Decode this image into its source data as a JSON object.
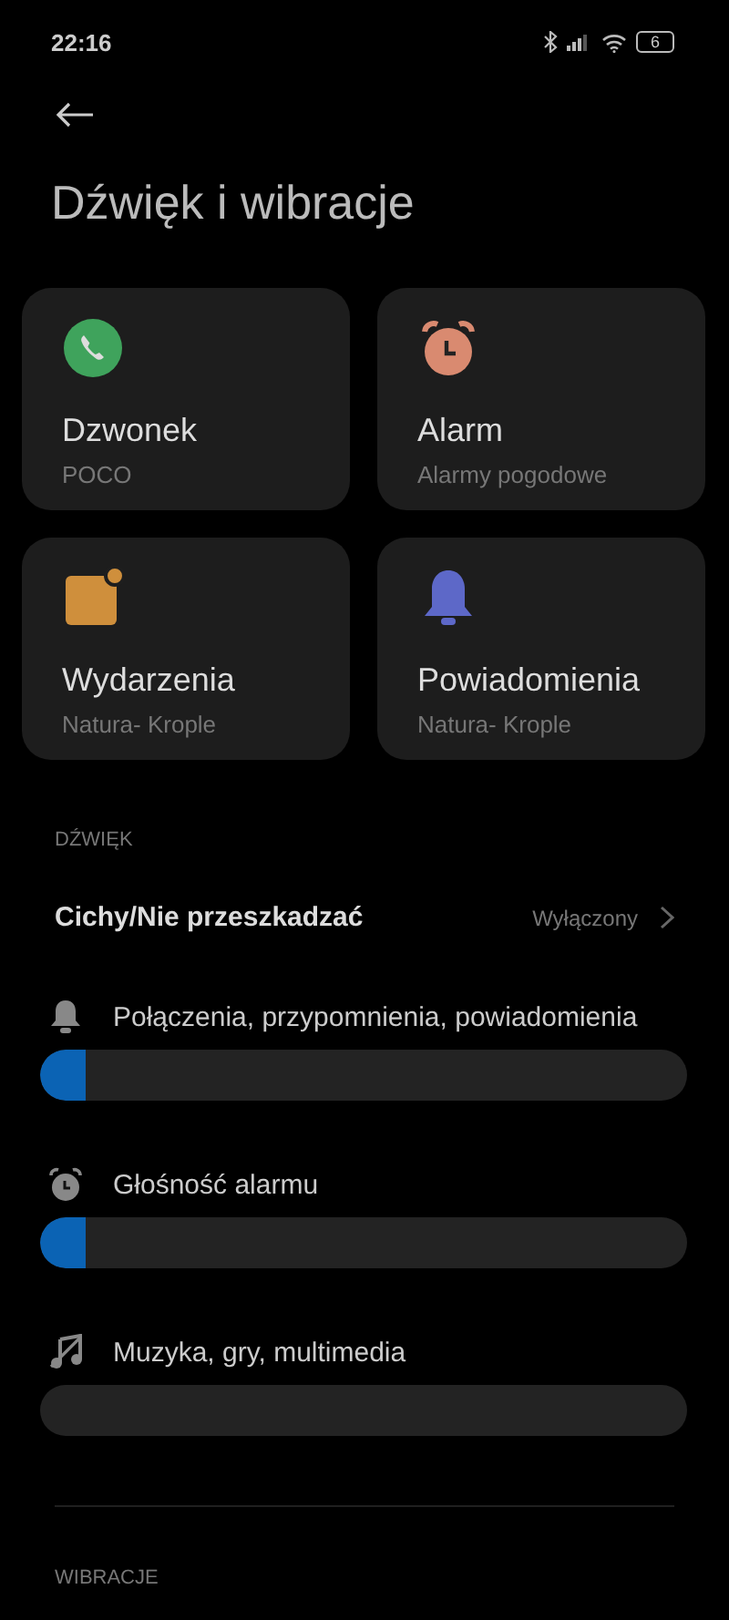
{
  "status_bar": {
    "time": "22:16",
    "battery": "6"
  },
  "title": "Dźwięk i wibracje",
  "tiles": [
    {
      "kind": "phone",
      "label": "Dzwonek",
      "value": "POCO"
    },
    {
      "kind": "alarm",
      "label": "Alarm",
      "value": "Alarmy pogodowe"
    },
    {
      "kind": "event",
      "label": "Wydarzenia",
      "value": "Natura- Krople"
    },
    {
      "kind": "bell",
      "label": "Powiadomienia",
      "value": "Natura- Krople"
    }
  ],
  "sound_section": {
    "heading": "DŹWIĘK",
    "dnd": {
      "label": "Cichy/Nie przeszkadzać",
      "value": "Wyłączony"
    },
    "volumes": [
      {
        "kind": "bell",
        "label": "Połączenia, przypomnienia, powiadomienia",
        "level": 0.07
      },
      {
        "kind": "alarm",
        "label": "Głośność alarmu",
        "level": 0.07
      },
      {
        "kind": "music-off",
        "label": "Muzyka, gry, multimedia"
      }
    ]
  },
  "vibration_section": {
    "heading": "WIBRACJE"
  }
}
